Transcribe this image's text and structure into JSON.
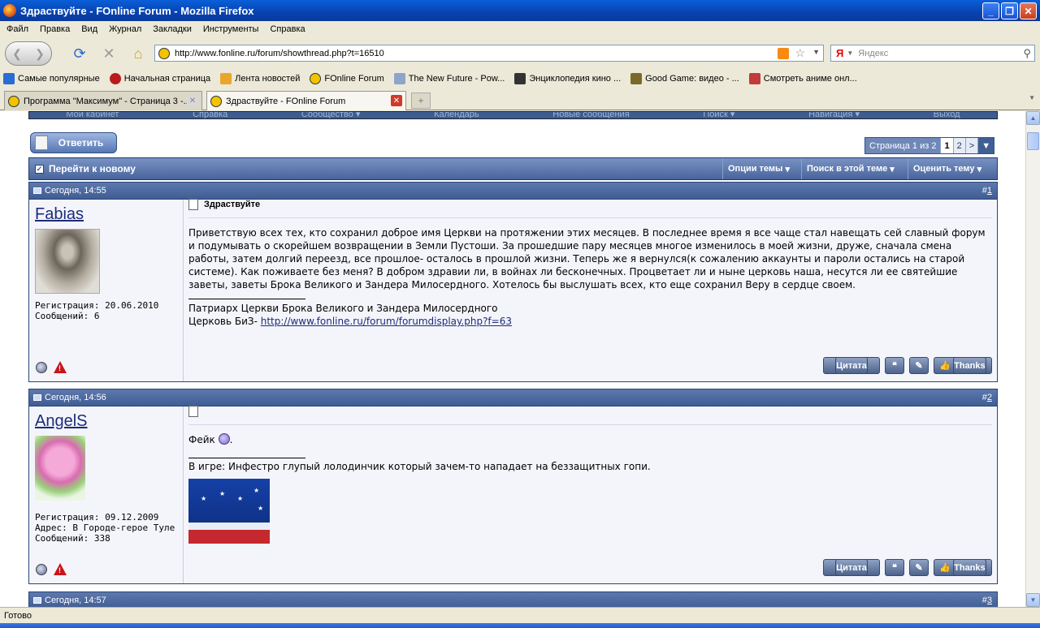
{
  "window": {
    "title": "Здраствуйте - FOnline Forum - Mozilla Firefox"
  },
  "menu": [
    "Файл",
    "Правка",
    "Вид",
    "Журнал",
    "Закладки",
    "Инструменты",
    "Справка"
  ],
  "address": {
    "url": "http://www.fonline.ru/forum/showthread.php?t=16510"
  },
  "search": {
    "placeholder": "Яндекс",
    "engine_letter": "Я"
  },
  "bookmarks": [
    "Самые популярные",
    "Начальная страница",
    "Лента новостей",
    "FOnline Forum",
    "The New Future - Pow...",
    "Энциклопедия кино ...",
    "Good Game: видео - ...",
    "Смотреть аниме онл..."
  ],
  "tabs": [
    {
      "label": "Программа \"Максимум\" - Страница 3 -..."
    },
    {
      "label": "Здраствуйте - FOnline Forum"
    }
  ],
  "status": "Готово",
  "forum": {
    "navlinks": [
      "Мой кабинет",
      "Справка",
      "Сообщество ▾",
      "Календарь",
      "Новые сообщения",
      "Поиск ▾",
      "Навигация ▾",
      "Выход"
    ],
    "reply_label": "Ответить",
    "pager": {
      "label": "Страница 1 из 2",
      "current": "1",
      "next": "2",
      "arrow": ">"
    },
    "goto_new": "Перейти к новому",
    "options": [
      "Опции темы",
      "Поиск в этой теме",
      "Оценить тему"
    ],
    "posts": [
      {
        "date": "Сегодня, 14:55",
        "number": "1",
        "username": "Fabias",
        "reg": "Регистрация: 20.06.2010",
        "count": "Сообщений: 6",
        "title": "Здраствуйте",
        "body": "Приветствую всех тех, кто сохранил доброе имя Церкви на протяжении этих месяцев. В последнее время я все чаще стал навещать сей славный форум и подумывать о скорейшем возвращении в Земли Пустоши. За прошедшие пару месяцев многое изменилось в моей жизни, друже, сначала смена работы, затем долгий переезд, все прошлое- осталось в прошлой жизни. Теперь же я вернулся(к сожалению аккаунты и пароли остались на старой системе). Как поживаете без меня? В добром здравии ли, в войнах ли бесконечных. Процветает ли и ныне церковь наша, несутся ли ее святейшие заветы, заветы Брока Великого и Зандера Милосердного. Хотелось бы выслушать всех, кто еще сохранил Веру в сердце своем.",
        "sig1": "Патриарх Церкви Брока Великого и Зандера Милосердного",
        "sig2_prefix": "Церковь БиЗ- ",
        "sig2_link": "http://www.fonline.ru/forum/forumdisplay.php?f=63"
      },
      {
        "date": "Сегодня, 14:56",
        "number": "2",
        "username": "AngelS",
        "reg": "Регистрация: 09.12.2009",
        "addr": "Адрес: В Городе-герое Туле",
        "count": "Сообщений: 338",
        "body": "Фейк",
        "sig1": "В игре: Инфестро глупый лолодинчик который зачем-то нападает на беззащитных гопи."
      },
      {
        "date": "Сегодня, 14:57",
        "number": "3"
      }
    ],
    "buttons": {
      "quote": "Цитата",
      "thanks": "Thanks"
    }
  }
}
